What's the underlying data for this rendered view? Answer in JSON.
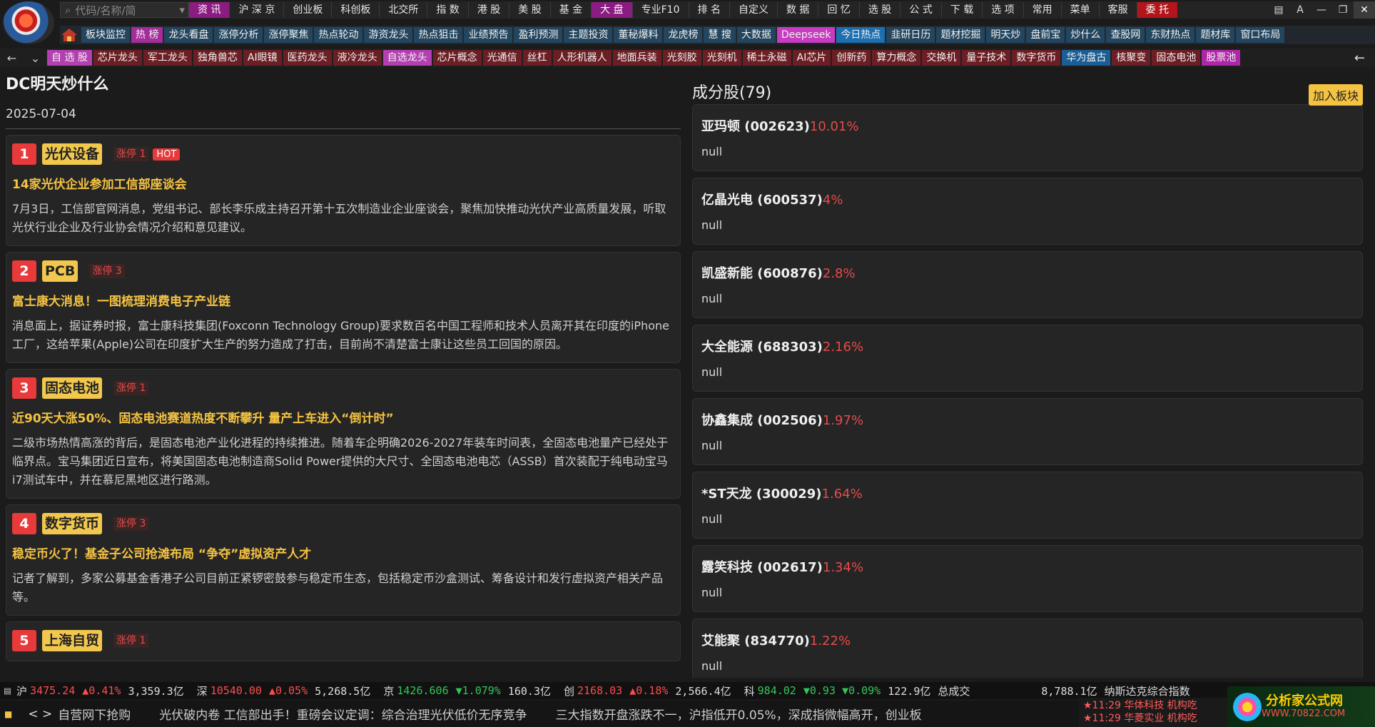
{
  "toolbar_top": {
    "search_placeholder": "代码/名称/简",
    "buttons": [
      "资 讯",
      "沪 深 京",
      "创业板",
      "科创板",
      "北交所",
      "指 数",
      "港 股",
      "美 股",
      "基 金",
      "大 盘",
      "专业F10",
      "排 名",
      "自定义",
      "数 据",
      "回 忆",
      "选 股",
      "公 式",
      "下 载",
      "选 项",
      "常用",
      "菜单",
      "客服",
      "委 托"
    ],
    "active_index": 0,
    "active_index2": 9,
    "red_index": 22
  },
  "toolbar_second": [
    "板块监控",
    "热 榜",
    "龙头看盘",
    "涨停分析",
    "涨停聚焦",
    "热点轮动",
    "游资龙头",
    "热点狙击",
    "业绩预告",
    "盈利预测",
    "主题投资",
    "董秘爆料",
    "龙虎榜",
    "慧 搜",
    "大数据",
    "Deepseek",
    "今日热点",
    "韭研日历",
    "题材挖掘",
    "明天炒",
    "盘前宝",
    "炒什么",
    "查股网",
    "东财热点",
    "题材库",
    "窗口布局"
  ],
  "toolbar_third": [
    "自 选 股",
    "芯片龙头",
    "军工龙头",
    "独角兽芯",
    "AI眼镜",
    "医药龙头",
    "液冷龙头",
    "自选龙头",
    "芯片概念",
    "光通信",
    "丝杠",
    "人形机器人",
    "地面兵装",
    "光刻胶",
    "光刻机",
    "稀土永磁",
    "AI芯片",
    "创新药",
    "算力概念",
    "交换机",
    "量子技术",
    "数字货币",
    "华为盘古",
    "核聚变",
    "固态电池",
    "股票池"
  ],
  "news": {
    "title": "DC明天炒什么",
    "date": "2025-07-04",
    "items": [
      {
        "num": "1",
        "tag": "光伏设备",
        "limit": "涨停 1",
        "hot": "HOT",
        "headline": "14家光伏企业参加工信部座谈会",
        "body": "7月3日，工信部官网消息，党组书记、部长李乐成主持召开第十五次制造业企业座谈会，聚焦加快推动光伏产业高质量发展，听取光伏行业企业及行业协会情况介绍和意见建议。"
      },
      {
        "num": "2",
        "tag": "PCB",
        "limit": "涨停 3",
        "hot": "",
        "headline": "富士康大消息！一图梳理消费电子产业链",
        "body": "消息面上，据证券时报，富士康科技集团(Foxconn Technology Group)要求数百名中国工程师和技术人员离开其在印度的iPhone工厂，这给苹果(Apple)公司在印度扩大生产的努力造成了打击，目前尚不清楚富士康让这些员工回国的原因。"
      },
      {
        "num": "3",
        "tag": "固态电池",
        "limit": "涨停 1",
        "hot": "",
        "headline": "近90天大涨50%、固态电池赛道热度不断攀升 量产上车进入“倒计时”",
        "body": "二级市场热情高涨的背后，是固态电池产业化进程的持续推进。随着车企明确2026-2027年装车时间表，全固态电池量产已经处于临界点。宝马集团近日宣布，将美国固态电池制造商Solid Power提供的大尺寸、全固态电池电芯（ASSB）首次装配于纯电动宝马i7测试车中，并在慕尼黑地区进行路测。"
      },
      {
        "num": "4",
        "tag": "数字货币",
        "limit": "涨停 3",
        "hot": "",
        "headline": "稳定币火了！基金子公司抢滩布局 “争夺”虚拟资产人才",
        "body": "记者了解到，多家公募基金香港子公司目前正紧锣密鼓参与稳定币生态，包括稳定币沙盒测试、筹备设计和发行虚拟资产相关产品等。"
      },
      {
        "num": "5",
        "tag": "上海自贸",
        "limit": "涨停 1",
        "hot": "",
        "headline": "",
        "body": ""
      }
    ]
  },
  "stocks": {
    "title": "成分股(79)",
    "add_label": "加入板块",
    "items": [
      {
        "name": "亚玛顿 (002623)",
        "pct": "10.01%",
        "note": "null"
      },
      {
        "name": "亿晶光电 (600537)",
        "pct": "4%",
        "note": "null"
      },
      {
        "name": "凯盛新能 (600876)",
        "pct": "2.8%",
        "note": "null"
      },
      {
        "name": "大全能源 (688303)",
        "pct": "2.16%",
        "note": "null"
      },
      {
        "name": "协鑫集成 (002506)",
        "pct": "1.97%",
        "note": "null"
      },
      {
        "name": "*ST天龙 (300029)",
        "pct": "1.64%",
        "note": "null"
      },
      {
        "name": "露笑科技 (002617)",
        "pct": "1.34%",
        "note": "null"
      },
      {
        "name": "艾能聚 (834770)",
        "pct": "1.22%",
        "note": "null"
      }
    ]
  },
  "status": {
    "sh": {
      "label": "沪",
      "price": "3475.24",
      "chg": "▲0.41%",
      "vol": "3,359.3亿"
    },
    "sz": {
      "label": "深",
      "price": "10540.00",
      "chg": "▲0.05%",
      "vol": "5,268.5亿"
    },
    "bj": {
      "label": "京",
      "price": "1426.606",
      "chg": "▼1.079%",
      "vol": "160.3亿"
    },
    "cy": {
      "label": "创",
      "price": "2168.03",
      "chg": "▲0.18%",
      "vol": "2,566.4亿"
    },
    "kc": {
      "label": "科",
      "price": "984.02",
      "chg": "▼0.93 ▼0.09%",
      "vol": "122.9亿"
    },
    "total_label": "总成交",
    "total": "8,788.1亿",
    "nasdaq_label": "纳斯达克综合指数"
  },
  "ticker": {
    "items": [
      "自营网下抢购",
      "光伏破内卷 工信部出手！重磅会议定调：综合治理光伏低价无序竞争",
      "三大指数开盘涨跌不一，沪指低开0.05%，深成指微幅高开，创业板"
    ],
    "alerts": [
      "★11:29 华体科技 机构吃",
      "★11:29 华菱实业 机构吃"
    ]
  },
  "brand": {
    "name": "分析家公式网",
    "url": "WWW.70822.COM"
  },
  "colors": {
    "accent_pink": "#8b1d82",
    "up_red": "#ff4b4b",
    "down_green": "#34c759",
    "tag_yellow": "#f1c84d",
    "headline_gold": "#f5c342"
  }
}
